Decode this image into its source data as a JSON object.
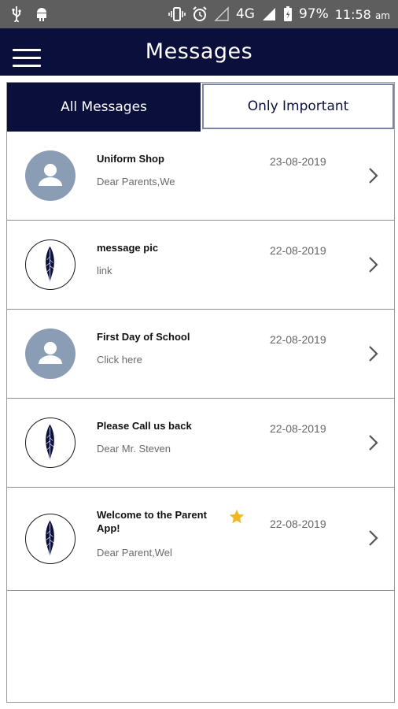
{
  "status_bar": {
    "network": "4G",
    "battery": "97%",
    "time": "11:58",
    "ampm": "am"
  },
  "header": {
    "title": "Messages"
  },
  "tabs": {
    "all": "All Messages",
    "important": "Only Important"
  },
  "messages": [
    {
      "title": "Uniform Shop",
      "preview": "Dear Parents,We",
      "date": "23-08-2019",
      "avatar": "person-icon",
      "important": false
    },
    {
      "title": "message pic",
      "preview": "link",
      "date": "22-08-2019",
      "avatar": "feather-icon",
      "important": false
    },
    {
      "title": "First Day of School",
      "preview": "Click here",
      "date": "22-08-2019",
      "avatar": "person-icon",
      "important": false
    },
    {
      "title": "Please Call us back",
      "preview": "Dear Mr. Steven",
      "date": "22-08-2019",
      "avatar": "feather-icon",
      "important": false
    },
    {
      "title": "Welcome to the Parent App!",
      "preview": "Dear Parent,Wel",
      "date": "22-08-2019",
      "avatar": "feather-icon",
      "important": true
    }
  ],
  "colors": {
    "primary": "#0b0f3c",
    "avatar_bg": "#8a9db4",
    "star": "#f2b821",
    "status_bar": "#5e5e5e"
  }
}
